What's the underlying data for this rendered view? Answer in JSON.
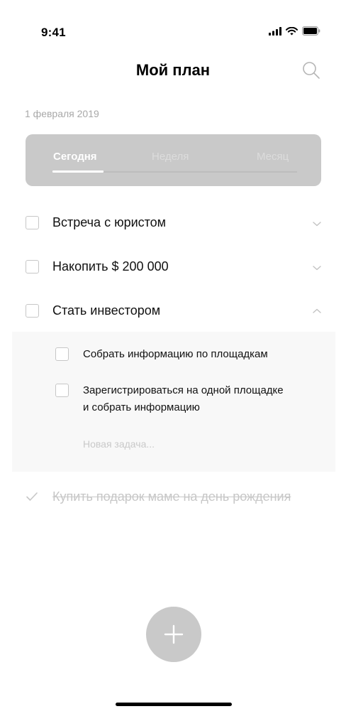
{
  "status_bar": {
    "time": "9:41",
    "icons": [
      "cellular-signal-icon",
      "wifi-icon",
      "battery-icon"
    ]
  },
  "header": {
    "title": "Мой план",
    "search_icon": "search-icon"
  },
  "date": "1 февраля 2019",
  "tabs": {
    "items": [
      {
        "label": "Сегодня",
        "active": true
      },
      {
        "label": "Неделя",
        "active": false
      },
      {
        "label": "Месяц",
        "active": false
      }
    ]
  },
  "tasks": [
    {
      "label": "Встреча с юристом",
      "checked": false,
      "expanded": false
    },
    {
      "label": "Накопить $ 200 000",
      "checked": false,
      "expanded": false
    },
    {
      "label": "Стать инвестором",
      "checked": false,
      "expanded": true,
      "subtasks": [
        {
          "label": "Собрать информацию по площадкам",
          "checked": false
        },
        {
          "label_line1": "Зарегистрироваться на одной площадке",
          "label_line2": "и собрать информацию",
          "checked": false
        }
      ],
      "new_task_placeholder": "Новая задача..."
    }
  ],
  "completed": [
    {
      "label": "Купить подарок маме на день рождения",
      "checked": true
    }
  ],
  "fab": {
    "icon": "plus-icon"
  },
  "colors": {
    "accent_gray": "#c9c9c9",
    "text": "#111111",
    "muted": "#a8a8a8",
    "panel_bg": "#f8f8f8"
  }
}
